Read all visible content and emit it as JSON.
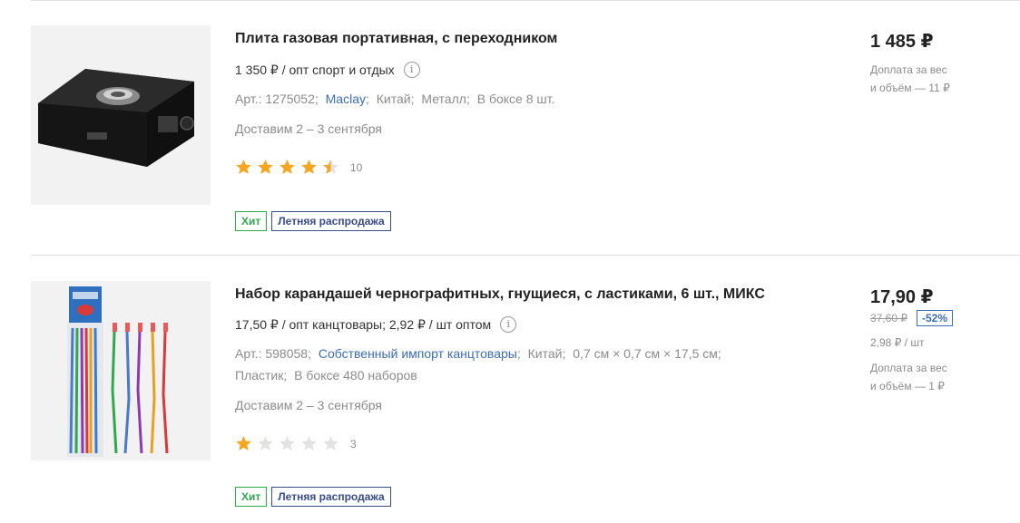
{
  "colors": {
    "link": "#3c6eb4",
    "hit_badge": "#2fa84f",
    "sale_badge": "#3a4c8c",
    "star_filled": "#f5a623",
    "star_empty": "#e3e3e3"
  },
  "products": [
    {
      "image_icon": "gas-stove-image",
      "title": "Плита газовая портативная, с переходником",
      "wholesale_text": "1 350 ₽ / опт спорт и отдых",
      "info_icon": "info-icon",
      "meta": {
        "article": "Арт.: 1275052;",
        "brand": "Maclay",
        "brand_sep": ";",
        "country": "Китай;",
        "material": "Металл;",
        "packing": "В боксе 8 шт."
      },
      "delivery": "Доставим 2 – 3 сентября",
      "rating": {
        "value": 4.5,
        "max": 5,
        "count": "10"
      },
      "badges": {
        "hit": "Хит",
        "sale": "Летняя распродажа"
      },
      "price": "1 485 ₽",
      "extra_line1": "Доплата за вес",
      "extra_line2": "и объём — 11 ₽"
    },
    {
      "image_icon": "pencils-image",
      "title": "Набор карандашей чернографитных, гнущиеся, с ластиками, 6 шт., МИКС",
      "wholesale_text": "17,50 ₽ / опт канцтовары; 2,92 ₽ / шт оптом",
      "info_icon": "info-icon",
      "meta": {
        "article": "Арт.: 598058;",
        "brand": "Собственный импорт канцтовары",
        "brand_sep": ";",
        "country": "Китай;",
        "size": "0,7 см × 0,7 см × 17,5 см;",
        "material": "Пластик;",
        "packing": "В боксе 480 наборов"
      },
      "delivery": "Доставим 2 – 3 сентября",
      "rating": {
        "value": 1,
        "max": 5,
        "count": "3"
      },
      "badges": {
        "hit": "Хит",
        "sale": "Летняя распродажа"
      },
      "price": "17,90 ₽",
      "old_price": "37,60 ₽",
      "discount": "-52%",
      "unit_price": "2,98 ₽ / шт",
      "extra_line1": "Доплата за вес",
      "extra_line2": "и объём — 1 ₽"
    }
  ]
}
